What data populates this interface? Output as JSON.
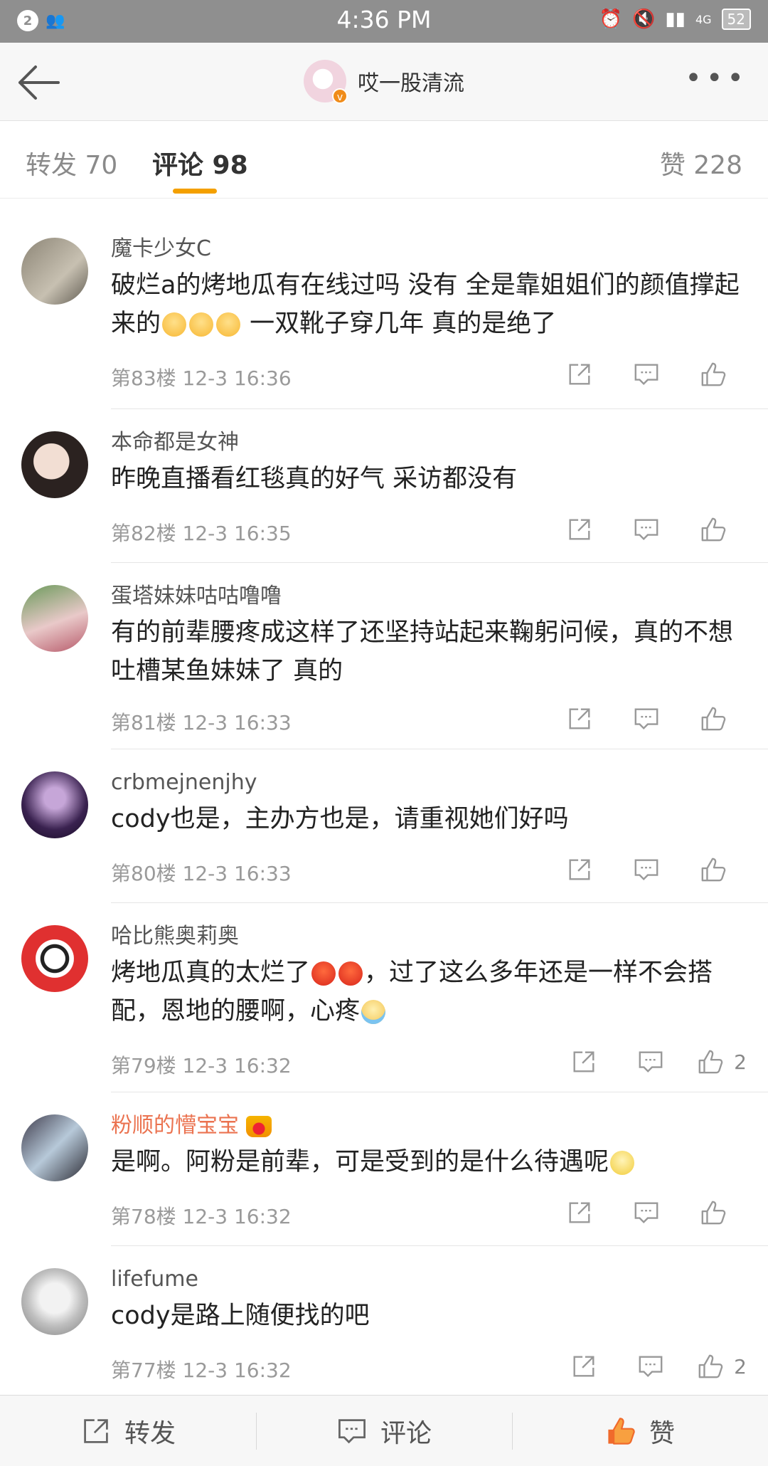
{
  "statusbar": {
    "notification_count": "2",
    "time": "4:36 PM",
    "network": "4G",
    "battery": "52"
  },
  "nav": {
    "title": "哎一股清流",
    "avatar_badge": "v"
  },
  "tabs": {
    "repost": "转发 70",
    "comment": "评论 98",
    "like": "赞 228"
  },
  "comments": [
    {
      "name": "魔卡少女C",
      "text_a": "破烂a的烤地瓜有在线过吗 没有 全是靠姐姐们的颜值撑起来的",
      "emoji": [
        "cry",
        "cry",
        "cry"
      ],
      "text_b": " 一双靴子穿几年 真的是绝了",
      "meta": "第83楼  12-3 16:36",
      "likes": ""
    },
    {
      "name": "本命都是女神",
      "text_a": "昨晚直播看红毯真的好气   采访都没有",
      "emoji": [],
      "text_b": "",
      "meta": "第82楼  12-3 16:35",
      "likes": ""
    },
    {
      "name": "蛋塔妹妹咕咕噜噜",
      "text_a": "有的前辈腰疼成这样了还坚持站起来鞠躬问候，真的不想吐槽某鱼妹妹了 真的",
      "emoji": [],
      "text_b": "",
      "meta": "第81楼  12-3 16:33",
      "likes": ""
    },
    {
      "name": "crbmejnenjhy",
      "text_a": "cody也是，主办方也是，请重视她们好吗",
      "emoji": [],
      "text_b": "",
      "meta": "第80楼  12-3 16:33",
      "likes": ""
    },
    {
      "name": "哈比熊奥莉奥",
      "text_a": "烤地瓜真的太烂了",
      "emoji": [
        "angry",
        "angry"
      ],
      "text_b": "，过了这么多年还是一样不会搭配，恩地的腰啊，心疼",
      "emoji_end": "sob",
      "meta": "第79楼  12-3 16:32",
      "likes": "2"
    },
    {
      "name": "粉顺的懵宝宝",
      "text_a": "是啊。阿粉是前辈，可是受到的是什么待遇呢",
      "emoji": [],
      "text_b": "",
      "emoji_end": "smile",
      "meta": "第78楼  12-3 16:32",
      "likes": ""
    },
    {
      "name": "lifefume",
      "text_a": "cody是路上随便找的吧",
      "emoji": [],
      "text_b": "",
      "meta": "第77楼  12-3 16:32",
      "likes": "2"
    }
  ],
  "bottombar": {
    "repost": "转发",
    "comment": "评论",
    "like": "赞"
  },
  "colors": {
    "accent": "#f4a000",
    "orange_name": "#eb7350",
    "like_active": "#f06a2c"
  }
}
